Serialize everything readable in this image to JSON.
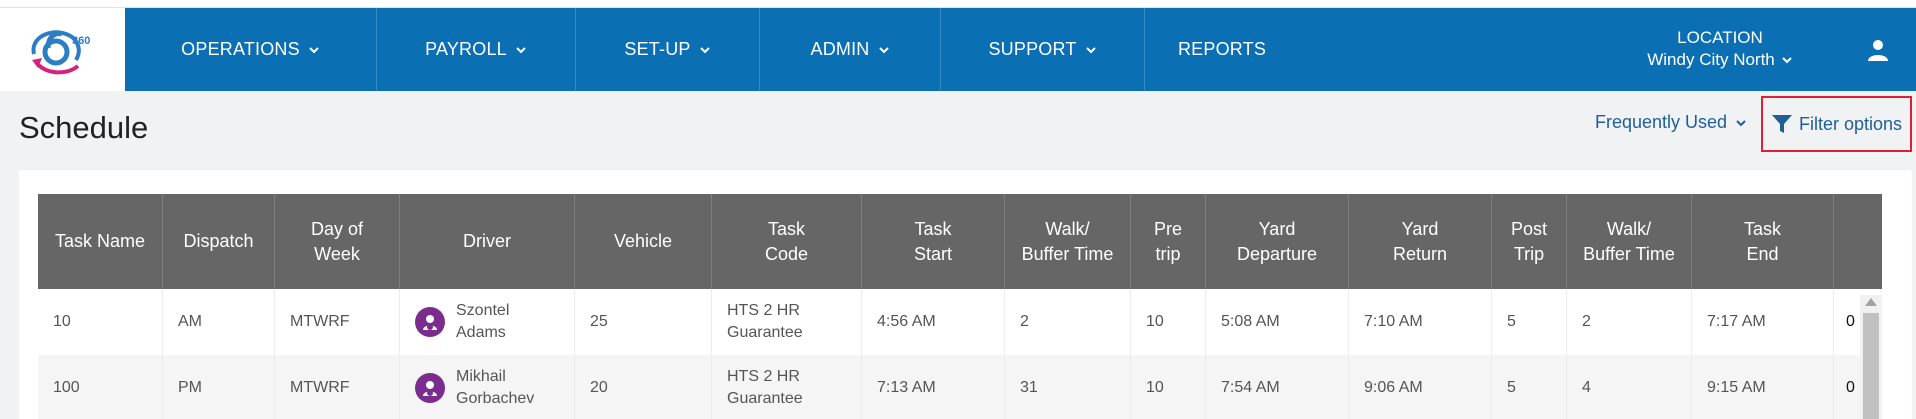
{
  "nav": {
    "logo_text": "360",
    "items": [
      {
        "label": "OPERATIONS",
        "has_dropdown": true
      },
      {
        "label": "PAYROLL",
        "has_dropdown": true
      },
      {
        "label": "SET-UP",
        "has_dropdown": true
      },
      {
        "label": "ADMIN",
        "has_dropdown": true
      },
      {
        "label": "SUPPORT",
        "has_dropdown": true
      },
      {
        "label": "REPORTS",
        "has_dropdown": false
      }
    ],
    "location_label": "LOCATION",
    "location_value": "Windy City North",
    "user_icon": "user-icon"
  },
  "page": {
    "title": "Schedule",
    "frequently_used": "Frequently Used",
    "filter_options": "Filter options"
  },
  "colors": {
    "nav_bg": "#0a6fb3",
    "header_bg": "#666666",
    "filter_border": "#e21d36",
    "link": "#1f5e96",
    "avatar": "#7b2d8e"
  },
  "table": {
    "headers": [
      {
        "line1": "Task Name",
        "line2": ""
      },
      {
        "line1": "Dispatch",
        "line2": ""
      },
      {
        "line1": "Day of",
        "line2": "Week"
      },
      {
        "line1": "Driver",
        "line2": ""
      },
      {
        "line1": "Vehicle",
        "line2": ""
      },
      {
        "line1": "Task",
        "line2": "Code"
      },
      {
        "line1": "Task",
        "line2": "Start"
      },
      {
        "line1": "Walk/",
        "line2": "Buffer Time"
      },
      {
        "line1": "Pre",
        "line2": "trip"
      },
      {
        "line1": "Yard",
        "line2": "Departure"
      },
      {
        "line1": "Yard",
        "line2": "Return"
      },
      {
        "line1": "Post",
        "line2": "Trip"
      },
      {
        "line1": "Walk/",
        "line2": "Buffer Time"
      },
      {
        "line1": "Task",
        "line2": "End"
      }
    ],
    "rows": [
      {
        "task_name": "10",
        "dispatch": "AM",
        "day_of_week": "MTWRF",
        "driver_first": "Szontel",
        "driver_last": "Adams",
        "vehicle": "25",
        "task_code_1": "HTS 2 HR",
        "task_code_2": "Guarantee",
        "task_start": "4:56 AM",
        "walk_buffer_1": "2",
        "pre_trip": "10",
        "yard_departure": "5:08 AM",
        "yard_return": "7:10 AM",
        "post_trip": "5",
        "walk_buffer_2": "2",
        "task_end": "7:17 AM",
        "edge": "0"
      },
      {
        "task_name": "100",
        "dispatch": "PM",
        "day_of_week": "MTWRF",
        "driver_first": "Mikhail",
        "driver_last": "Gorbachev",
        "vehicle": "20",
        "task_code_1": "HTS 2 HR",
        "task_code_2": "Guarantee",
        "task_start": "7:13 AM",
        "walk_buffer_1": "31",
        "pre_trip": "10",
        "yard_departure": "7:54 AM",
        "yard_return": "9:06 AM",
        "post_trip": "5",
        "walk_buffer_2": "4",
        "task_end": "9:15 AM",
        "edge": "0"
      }
    ]
  }
}
